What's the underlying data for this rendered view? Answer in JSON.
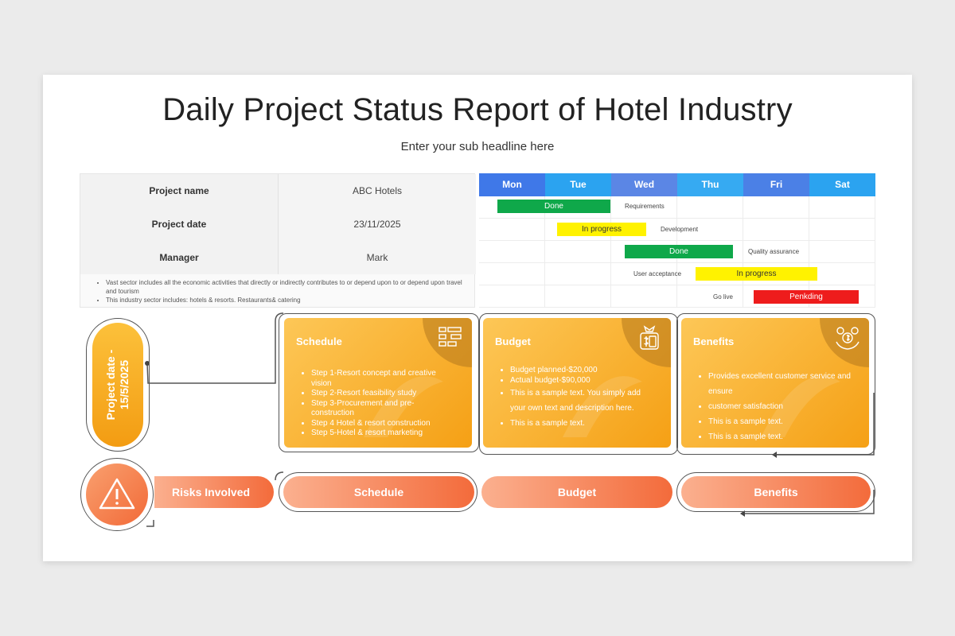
{
  "title": "Daily Project Status Report of Hotel Industry",
  "subtitle": "Enter your sub headline here",
  "info": {
    "rows": [
      {
        "label": "Project name",
        "value": "ABC Hotels"
      },
      {
        "label": "Project date",
        "value": "23/11/2025"
      },
      {
        "label": "Manager",
        "value": "Mark"
      }
    ],
    "notes": [
      "Vast sector includes all the economic activities that directly or indirectly contributes to or depend upon to or depend upon travel and tourism",
      "This industry sector includes: hotels & resorts. Restaurants& catering"
    ]
  },
  "gantt": {
    "days": [
      "Mon",
      "Tue",
      "Wed",
      "Thu",
      "Fri",
      "Sat"
    ],
    "tasks": [
      {
        "status": "Done",
        "label": "Requirements",
        "color": "#0fa84a"
      },
      {
        "status": "In progress",
        "label": "Development",
        "color": "#fff200"
      },
      {
        "status": "Done",
        "label": "Quality assurance",
        "color": "#0fa84a"
      },
      {
        "status": "In progress",
        "label": "User acceptance",
        "color": "#fff200"
      },
      {
        "status": "Penkding",
        "label": "Go live",
        "color": "#ee1c1c"
      }
    ]
  },
  "project_date": "Project date -\n15/5/2025",
  "cards": {
    "schedule": {
      "title": "Schedule",
      "items": [
        "Step 1-Resort concept and creative vision",
        "Step 2-Resort feasibility study",
        "Step 3-Procurement and pre-construction",
        "Step 4 Hotel & resort construction",
        "Step 5-Hotel & resort marketing"
      ]
    },
    "budget": {
      "title": "Budget",
      "items": [
        "Budget planned-$20,000",
        "Actual budget-$90,000",
        "This is a sample text. You simply add your own text and description here.",
        "This is a sample text."
      ]
    },
    "benefits": {
      "title": "Benefits",
      "items": [
        "Provides excellent customer service and ensure",
        "customer satisfaction",
        "This is a sample text.",
        "This is a sample text."
      ]
    }
  },
  "bottom": {
    "risks": "Risks Involved",
    "schedule": "Schedule",
    "budget": "Budget",
    "benefits": "Benefits"
  },
  "icons": {
    "warning": "warning-triangle-icon",
    "schedule": "gantt-chart-icon",
    "budget": "money-calculator-icon",
    "benefits": "money-hand-icon"
  }
}
